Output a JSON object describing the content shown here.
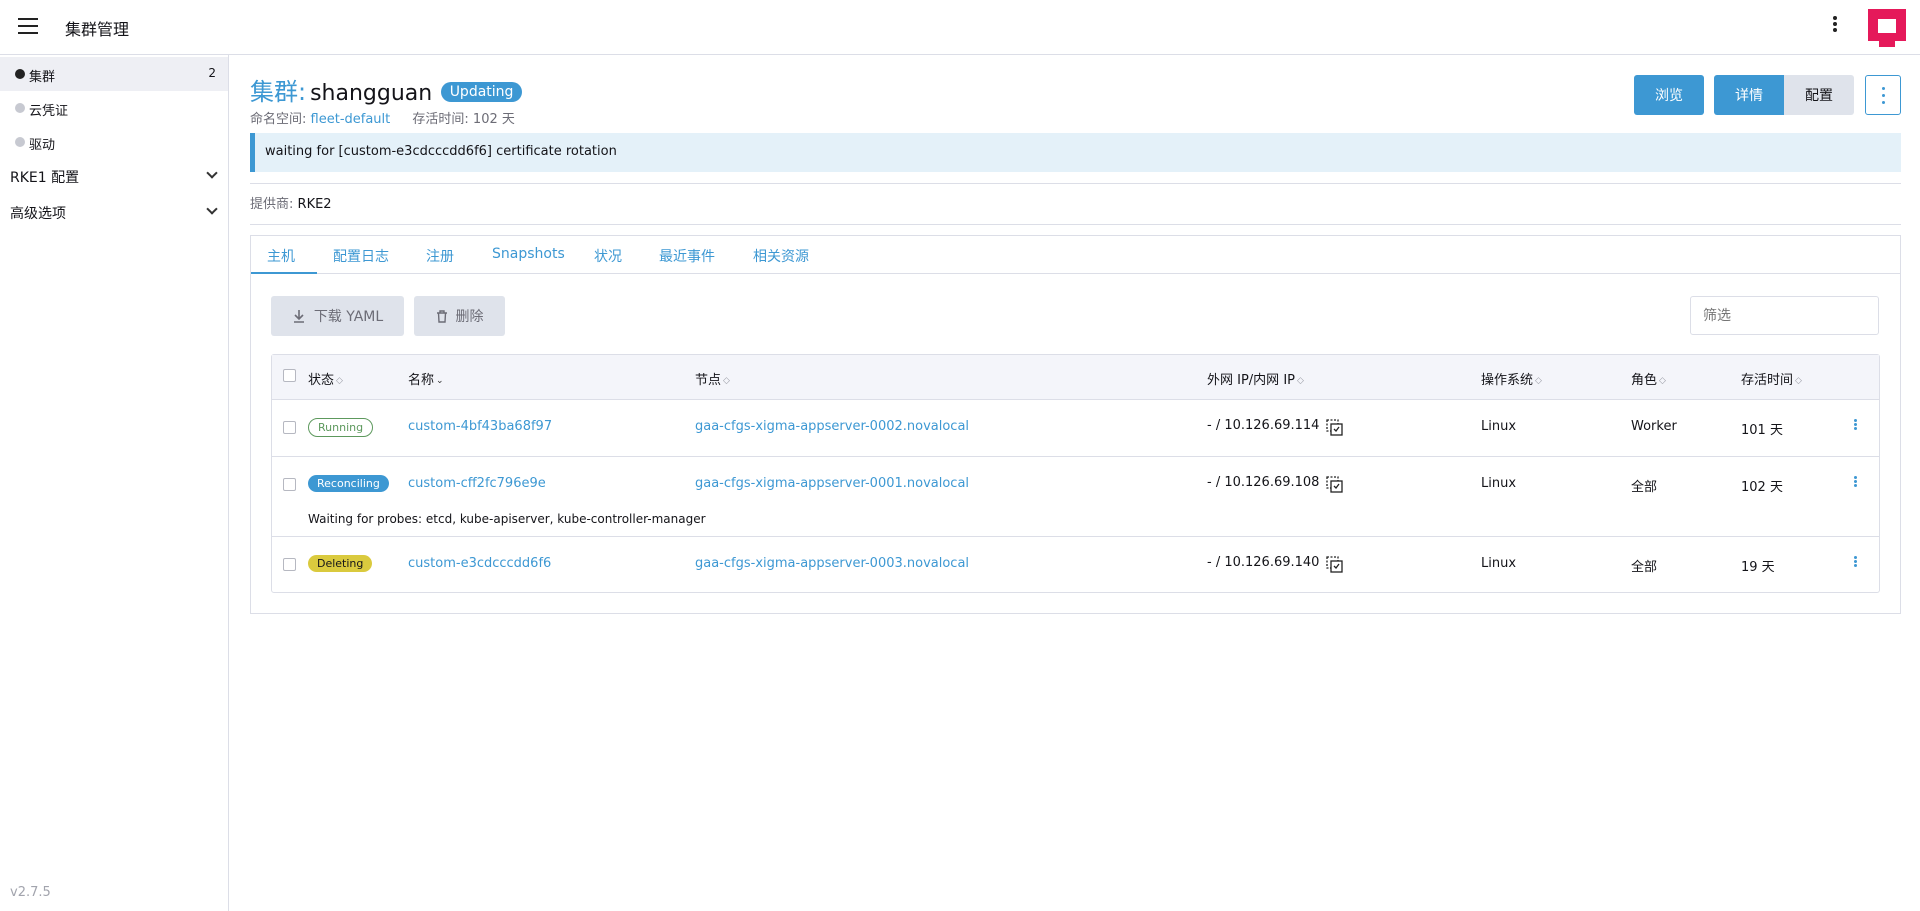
{
  "app": {
    "title": "集群管理",
    "version": "v2.7.5"
  },
  "sidebar": {
    "items": [
      {
        "label": "集群",
        "count": "2"
      },
      {
        "label": "云凭证"
      },
      {
        "label": "驱动"
      }
    ],
    "groups": [
      {
        "label": "RKE1 配置"
      },
      {
        "label": "高级选项"
      }
    ]
  },
  "cluster": {
    "prefix": "集群:",
    "name": "shangguan",
    "state": "Updating",
    "namespace_label": "命名空间:",
    "namespace": "fleet-default",
    "age_label": "存活时间:",
    "age": "102 天",
    "message": "waiting for [custom-e3cdcccdd6f6] certificate rotation",
    "provider_label": "提供商:",
    "provider": "RKE2"
  },
  "header_buttons": {
    "explore": "浏览",
    "detail": "详情",
    "config": "配置"
  },
  "tabs": [
    {
      "label": "主机"
    },
    {
      "label": "配置日志"
    },
    {
      "label": "注册"
    },
    {
      "label": "Snapshots"
    },
    {
      "label": "状况"
    },
    {
      "label": "最近事件"
    },
    {
      "label": "相关资源"
    }
  ],
  "actions": {
    "download": "下载 YAML",
    "delete": "删除",
    "filter_placeholder": "筛选"
  },
  "table": {
    "columns": [
      "状态",
      "名称",
      "节点",
      "外网 IP/内网 IP",
      "操作系统",
      "角色",
      "存活时间"
    ],
    "rows": [
      {
        "state": "Running",
        "name": "custom-4bf43ba68f97",
        "node": "gaa-cfgs-xigma-appserver-0002.novalocal",
        "ip": "- / 10.126.69.114",
        "os": "Linux",
        "role": "Worker",
        "age": "101 天"
      },
      {
        "state": "Reconciling",
        "name": "custom-cff2fc796e9e",
        "node": "gaa-cfgs-xigma-appserver-0001.novalocal",
        "ip": "- / 10.126.69.108",
        "os": "Linux",
        "role": "全部",
        "age": "102 天",
        "detail": "Waiting for probes: etcd, kube-apiserver, kube-controller-manager"
      },
      {
        "state": "Deleting",
        "name": "custom-e3cdcccdd6f6",
        "node": "gaa-cfgs-xigma-appserver-0003.novalocal",
        "ip": "- / 10.126.69.140",
        "os": "Linux",
        "role": "全部",
        "age": "19 天"
      }
    ]
  },
  "colors": {
    "accent": "#3d98d3",
    "running": "#5d995d",
    "deleting": "#daca3e",
    "logo": "#e5195a"
  },
  "icons": {
    "menu": "hamburger-icon",
    "more": "kebab-icon",
    "logo": "brand-logo-icon",
    "download": "download-icon",
    "trash": "trash-icon",
    "copy": "copy-icon",
    "chevron": "chevron-down-icon"
  }
}
